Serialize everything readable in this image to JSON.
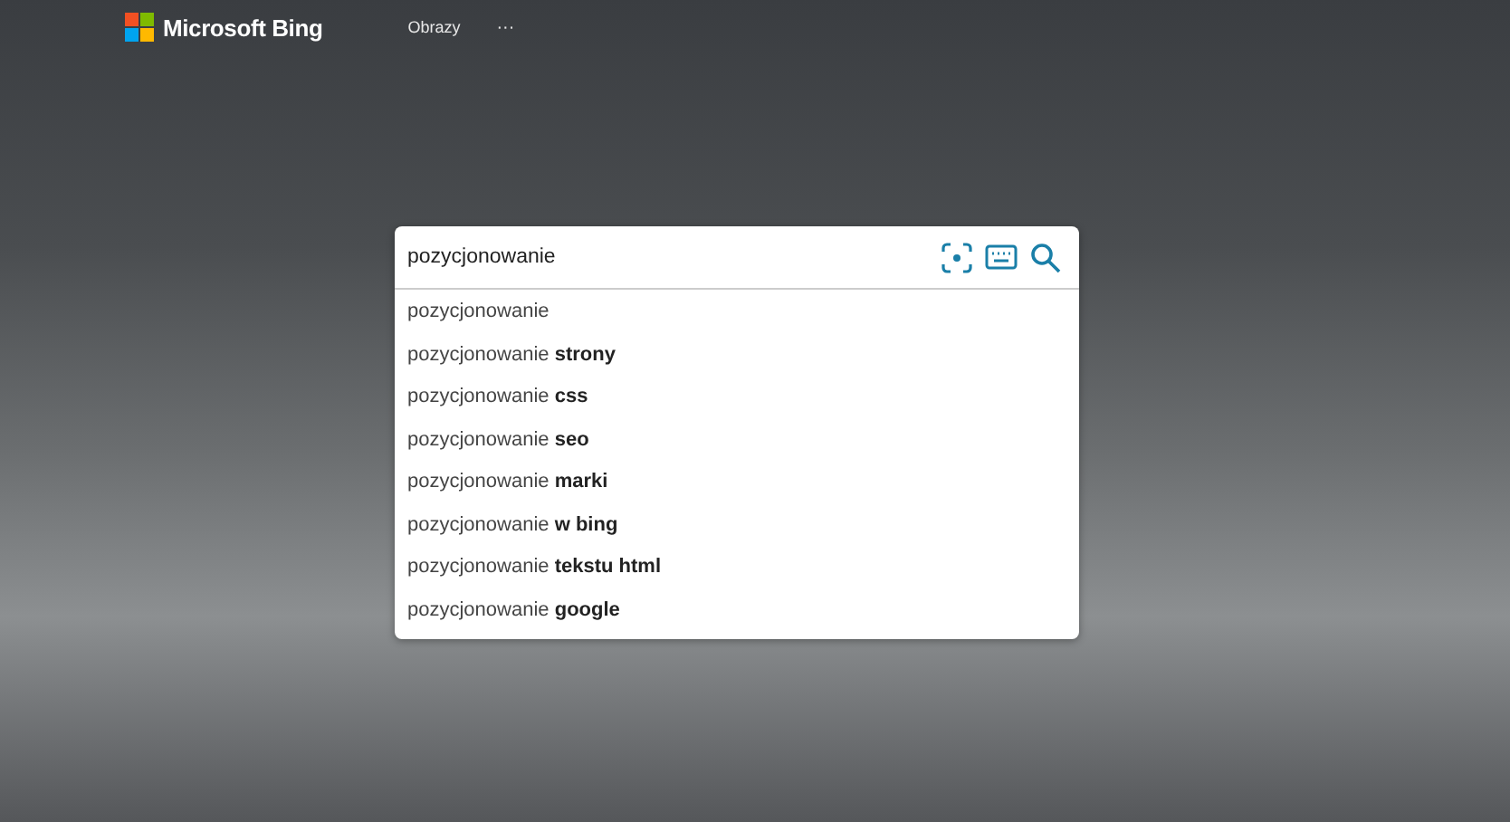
{
  "header": {
    "logo": "Microsoft Bing",
    "nav": [
      {
        "label": "Obrazy"
      },
      {
        "label": "···"
      }
    ]
  },
  "search": {
    "value": "pozycjonowanie"
  },
  "suggestions": [
    {
      "text": "pozycjonowanie"
    },
    {
      "text": "pozycjonowanie **strony**"
    },
    {
      "text": "pozycjonowanie **css**"
    },
    {
      "text": "pozycjonowanie **seo**"
    },
    {
      "text": "pozycjonowanie **marki**"
    },
    {
      "text": "pozycjonowanie **w bing**"
    },
    {
      "text": "pozycjonowanie **tekstu html**"
    },
    {
      "text": "pozycjonowanie **google**"
    }
  ]
}
